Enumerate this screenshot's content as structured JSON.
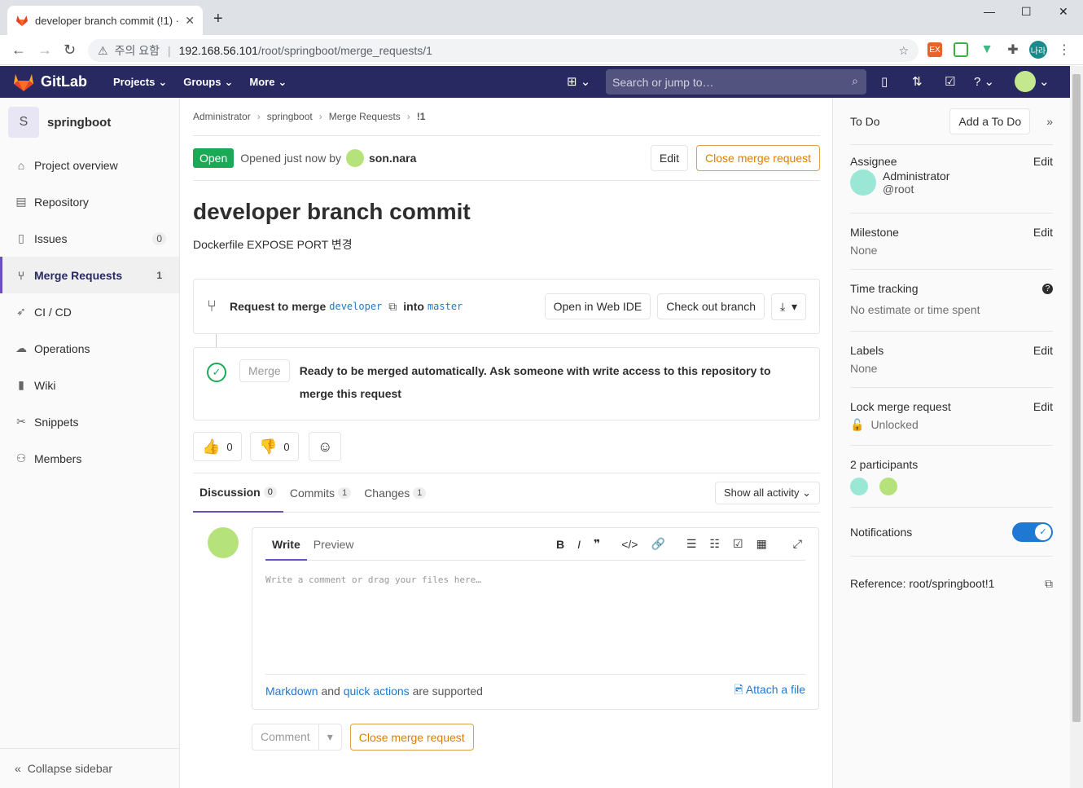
{
  "browser": {
    "tab_title": "developer branch commit (!1) ·",
    "close": "✕",
    "new_tab": "+",
    "warning": "주의 요함",
    "url_host": "192.168.56.101",
    "url_path": "/root/springboot/merge_requests/1",
    "profile": "나라"
  },
  "gitlab": {
    "brand": "GitLab",
    "menus": [
      "Projects",
      "Groups",
      "More"
    ],
    "search_placeholder": "Search or jump to…"
  },
  "sidebar": {
    "project_letter": "S",
    "project_name": "springboot",
    "items": [
      {
        "label": "Project overview",
        "icon": "home-icon"
      },
      {
        "label": "Repository",
        "icon": "book-icon"
      },
      {
        "label": "Issues",
        "icon": "issues-icon",
        "count": "0"
      },
      {
        "label": "Merge Requests",
        "icon": "merge-request-icon",
        "count": "1"
      },
      {
        "label": "CI / CD",
        "icon": "rocket-icon"
      },
      {
        "label": "Operations",
        "icon": "cloud-gear-icon"
      },
      {
        "label": "Wiki",
        "icon": "wiki-icon"
      },
      {
        "label": "Snippets",
        "icon": "scissors-icon"
      },
      {
        "label": "Members",
        "icon": "users-icon"
      }
    ],
    "collapse": "Collapse sidebar"
  },
  "breadcrumb": [
    "Administrator",
    "springboot",
    "Merge Requests",
    "!1"
  ],
  "mr": {
    "state": "Open",
    "opened": "Opened just now by",
    "author": "son.nara",
    "edit": "Edit",
    "close": "Close merge request",
    "title": "developer branch commit",
    "description": "Dockerfile EXPOSE PORT 변경",
    "request_prefix": "Request to merge",
    "source_branch": "developer",
    "into": "into",
    "target_branch": "master",
    "open_web_ide": "Open in Web IDE",
    "checkout": "Check out branch",
    "merge_btn": "Merge",
    "merge_status": "Ready to be merged automatically. Ask someone with write access to this repository to merge this request",
    "thumbs_up": "0",
    "thumbs_down": "0"
  },
  "tabs": [
    {
      "label": "Discussion",
      "count": "0"
    },
    {
      "label": "Commits",
      "count": "1"
    },
    {
      "label": "Changes",
      "count": "1"
    }
  ],
  "activity_filter": "Show all activity",
  "editor": {
    "write": "Write",
    "preview": "Preview",
    "placeholder": "Write a comment or drag your files here…",
    "markdown": "Markdown",
    "and": "and",
    "quick_actions": "quick actions",
    "supported": "are supported",
    "attach": "Attach a file",
    "comment": "Comment",
    "close": "Close merge request"
  },
  "right": {
    "todo": "To Do",
    "add_todo": "Add a To Do",
    "assignee_label": "Assignee",
    "assignee_name": "Administrator",
    "assignee_handle": "@root",
    "milestone_label": "Milestone",
    "milestone_val": "None",
    "time_label": "Time tracking",
    "time_val": "No estimate or time spent",
    "labels_label": "Labels",
    "labels_val": "None",
    "lock_label": "Lock merge request",
    "lock_val": "Unlocked",
    "participants": "2 participants",
    "notifications": "Notifications",
    "reference": "Reference: root/springboot!1",
    "edit": "Edit"
  },
  "colors": {
    "navbar": "#292961",
    "open_badge": "#1aaa55",
    "warning": "#de7e00",
    "link": "#1f78d1",
    "toggle": "#1f78d1"
  }
}
